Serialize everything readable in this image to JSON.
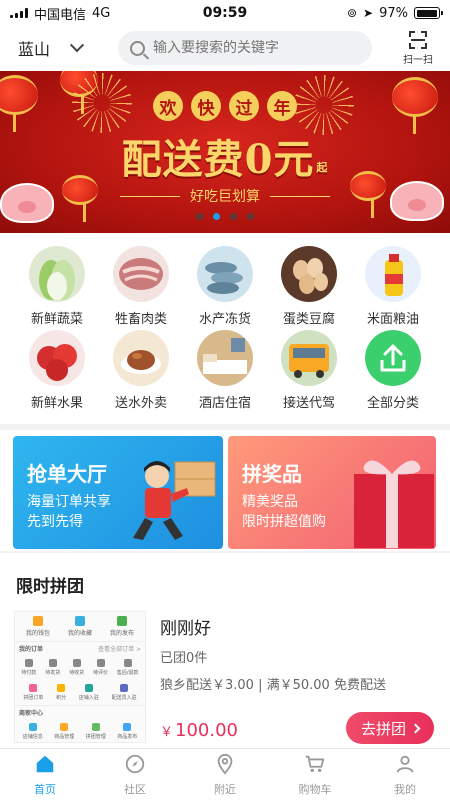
{
  "status_bar": {
    "carrier": "中国电信",
    "network": "4G",
    "time": "09:59",
    "battery": "97%",
    "battery_level": 0.97
  },
  "header": {
    "city": "蓝山",
    "search_placeholder": "输入要搜索的关键字",
    "scan_label": "扫一扫"
  },
  "banner": {
    "top_chars": [
      "欢",
      "快",
      "过",
      "年"
    ],
    "headline": "配送费0元",
    "headline_suffix": "起",
    "subline": "好吃巨划算",
    "dot_count": 4,
    "active_dot": 1
  },
  "categories": [
    {
      "label": "新鲜蔬菜",
      "icon": "vegetables-icon"
    },
    {
      "label": "牲畜肉类",
      "icon": "meat-icon"
    },
    {
      "label": "水产冻货",
      "icon": "seafood-icon"
    },
    {
      "label": "蛋类豆腐",
      "icon": "eggs-icon"
    },
    {
      "label": "米面粮油",
      "icon": "oil-icon"
    },
    {
      "label": "新鲜水果",
      "icon": "fruit-icon"
    },
    {
      "label": "送水外卖",
      "icon": "takeout-icon"
    },
    {
      "label": "酒店住宿",
      "icon": "hotel-icon"
    },
    {
      "label": "接送代驾",
      "icon": "bus-icon"
    },
    {
      "label": "全部分类",
      "icon": "upload-icon"
    }
  ],
  "promos": {
    "left": {
      "title": "抢单大厅",
      "line1": "海量订单共享",
      "line2": "先到先得"
    },
    "right": {
      "title": "拼奖品",
      "line1": "精美奖品",
      "line2": "限时拼超值购"
    }
  },
  "group_buy": {
    "section_title": "限时拼团",
    "thumb": {
      "row1": [
        "我的钱包",
        "我的收藏",
        "我的发布"
      ],
      "orders_title": "我的订单",
      "orders_more": "查看全部订单 >",
      "row2": [
        "待付款",
        "待发货",
        "待收货",
        "待评价",
        "售后/退款"
      ],
      "row3": [
        "拼团订单",
        "积分",
        "店铺入驻",
        "配送员入驻"
      ],
      "merchant_title": "商家中心",
      "row4": [
        "店铺信息",
        "商品管理",
        "拼团管理",
        "商品发布"
      ]
    },
    "product": {
      "name": "刚刚好",
      "joined": "已团0件",
      "shipping": "狼乡配送￥3.00 | 满￥50.00 免费配送",
      "currency": "￥",
      "price": "100.00",
      "button": "去拼团"
    }
  },
  "tabbar": [
    {
      "label": "首页",
      "icon": "home-icon",
      "active": true
    },
    {
      "label": "社区",
      "icon": "compass-icon",
      "active": false
    },
    {
      "label": "附近",
      "icon": "location-pin-icon",
      "active": false
    },
    {
      "label": "购物车",
      "icon": "cart-icon",
      "active": false
    },
    {
      "label": "我的",
      "icon": "user-icon",
      "active": false
    }
  ],
  "colors": {
    "accent": "#1aa0e8",
    "price": "#e8305a",
    "banner_red": "#c41a13",
    "gold": "#fbd66a"
  }
}
